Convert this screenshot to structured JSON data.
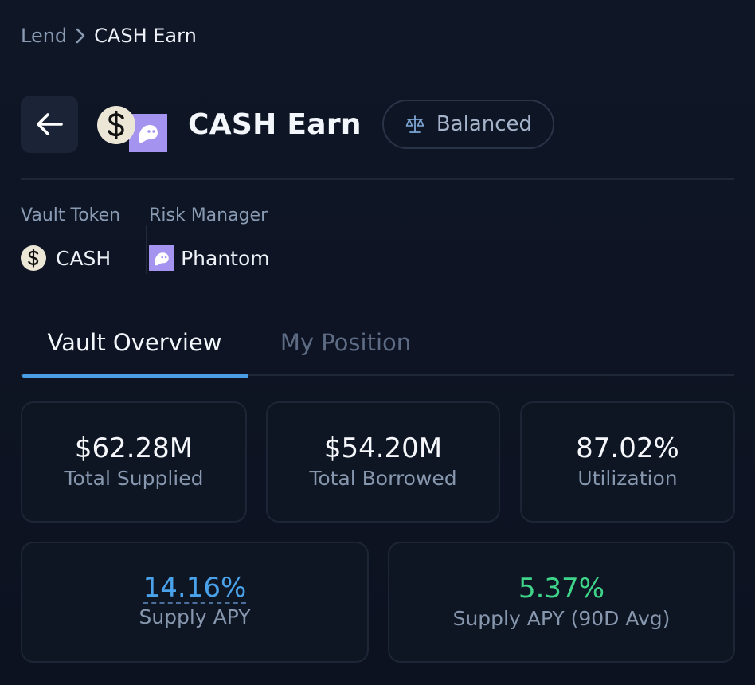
{
  "breadcrumb": {
    "parent": "Lend",
    "current": "CASH Earn"
  },
  "header": {
    "title": "CASH Earn",
    "risk_badge": "Balanced"
  },
  "meta": {
    "vault_token": {
      "label": "Vault Token",
      "value": "CASH"
    },
    "risk_manager": {
      "label": "Risk Manager",
      "value": "Phantom"
    }
  },
  "tabs": [
    {
      "label": "Vault Overview",
      "active": true
    },
    {
      "label": "My Position",
      "active": false
    }
  ],
  "stats": {
    "total_supplied": {
      "value": "$62.28M",
      "label": "Total Supplied"
    },
    "total_borrowed": {
      "value": "$54.20M",
      "label": "Total Borrowed"
    },
    "utilization": {
      "value": "87.02%",
      "label": "Utilization"
    },
    "supply_apy": {
      "value": "14.16%",
      "label": "Supply APY"
    },
    "supply_apy_90d": {
      "value": "5.37%",
      "label": "Supply APY (90D Avg)"
    }
  },
  "colors": {
    "background": "#0d1321",
    "accent_blue": "#4aa3ea",
    "accent_green": "#3ed48a",
    "phantom_purple": "#a593f0"
  },
  "icons": [
    "chevron-right-icon",
    "arrow-left-icon",
    "cash-token-icon",
    "phantom-icon",
    "scale-icon"
  ]
}
